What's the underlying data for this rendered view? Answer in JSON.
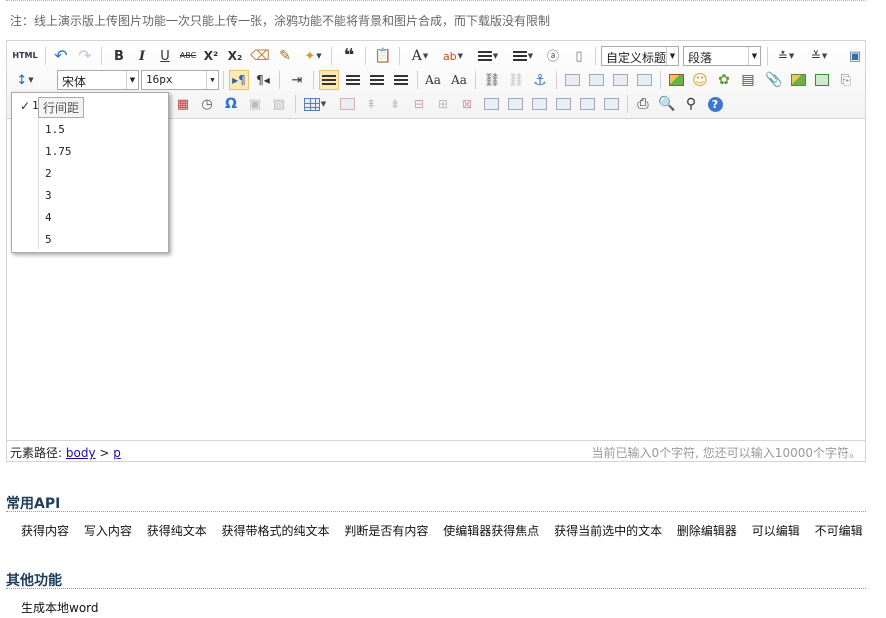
{
  "note": "注：线上演示版上传图片功能一次只能上传一张，涂鸦功能不能将背景和图片合成，而下载版没有限制",
  "toolbar": {
    "html_label": "HTML",
    "bold": "B",
    "italic": "I",
    "underline": "U",
    "strike": "ABC",
    "superscript": "X²",
    "subscript": "X₂",
    "quote": "❝",
    "font_color": "A",
    "custom_title": "自定义标题",
    "paragraph": "段落",
    "font_family": "宋体",
    "font_size": "16px",
    "omega": "Ω"
  },
  "line_height_menu": {
    "tooltip": "行间距",
    "checked": "1",
    "options": [
      "1.5",
      "1.75",
      "2",
      "3",
      "4",
      "5"
    ]
  },
  "status": {
    "path_label": "元素路径:",
    "path_body": "body",
    "path_sep": ">",
    "path_p": "p",
    "count_text": "当前已输入0个字符, 您还可以输入10000个字符。"
  },
  "sections": {
    "api_title": "常用API",
    "api_links": [
      "获得内容",
      "写入内容",
      "获得纯文本",
      "获得带格式的纯文本",
      "判断是否有内容",
      "使编辑器获得焦点",
      "获得当前选中的文本",
      "删除编辑器",
      "可以编辑",
      "不可编辑"
    ],
    "other_title": "其他功能",
    "other_link": "生成本地word"
  }
}
